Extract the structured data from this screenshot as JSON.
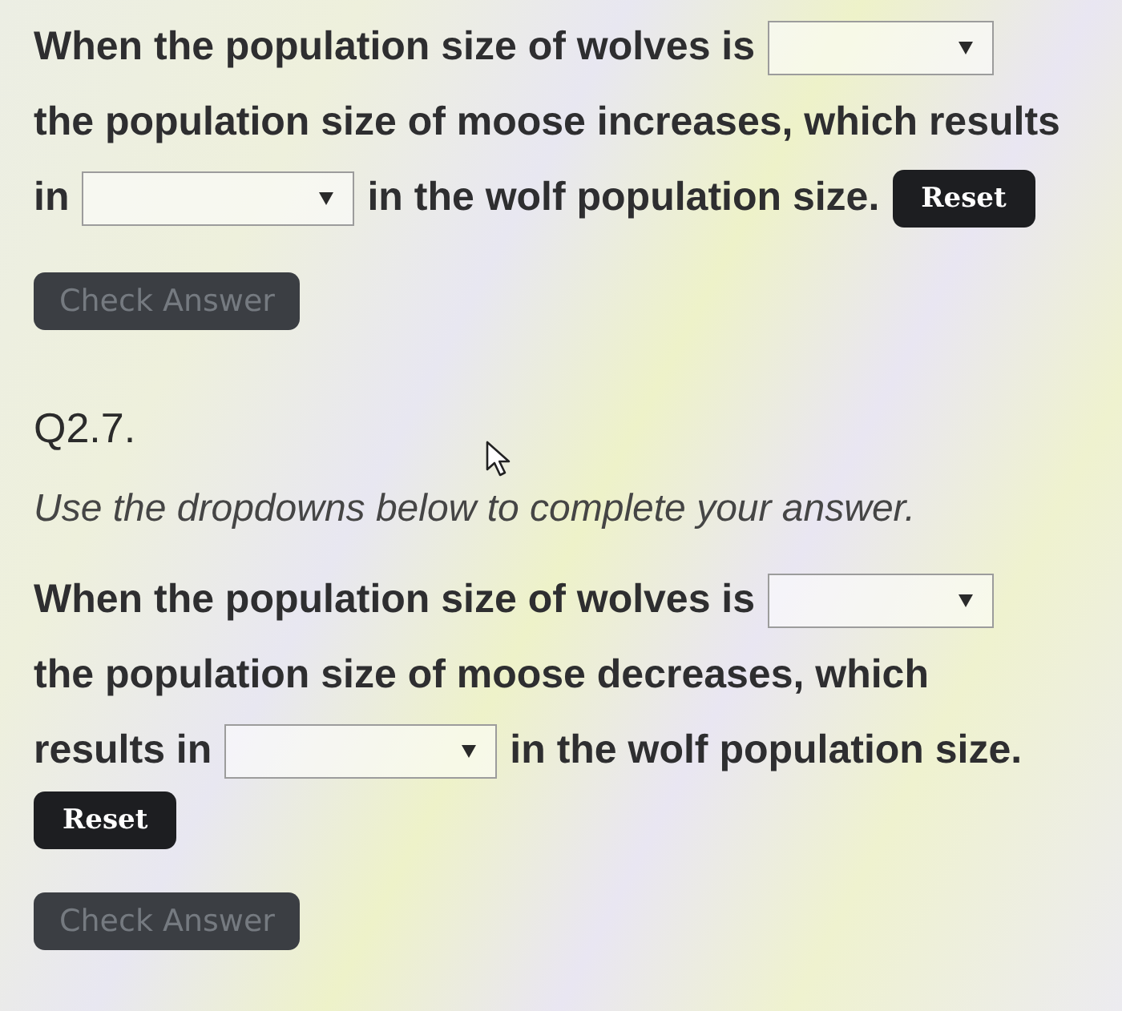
{
  "questions": [
    {
      "lines": [
        [
          {
            "kind": "text",
            "text": "When the population size of wolves is"
          },
          {
            "kind": "dropdown"
          }
        ],
        [
          {
            "kind": "text",
            "text": "the population size of moose increases, which results"
          }
        ],
        [
          {
            "kind": "text",
            "text": "in"
          },
          {
            "kind": "dropdown"
          },
          {
            "kind": "text",
            "text": "in the wolf population size."
          },
          {
            "kind": "button",
            "label": "Reset",
            "disabled": false
          }
        ]
      ],
      "check_button": {
        "label": "Check Answer",
        "disabled": true
      }
    },
    {
      "heading": "Q2.7.",
      "instruction": "Use the dropdowns below to complete your answer.",
      "lines": [
        [
          {
            "kind": "text",
            "text": "When the population size of wolves is"
          },
          {
            "kind": "dropdown"
          }
        ],
        [
          {
            "kind": "text",
            "text": "the population size of moose decreases, which"
          }
        ],
        [
          {
            "kind": "text",
            "text": "results in"
          },
          {
            "kind": "dropdown"
          },
          {
            "kind": "text",
            "text": "in the wolf population size."
          }
        ],
        [
          {
            "kind": "button",
            "label": "Reset",
            "disabled": false
          }
        ]
      ],
      "check_button": {
        "label": "Check Answer",
        "disabled": true
      }
    }
  ]
}
